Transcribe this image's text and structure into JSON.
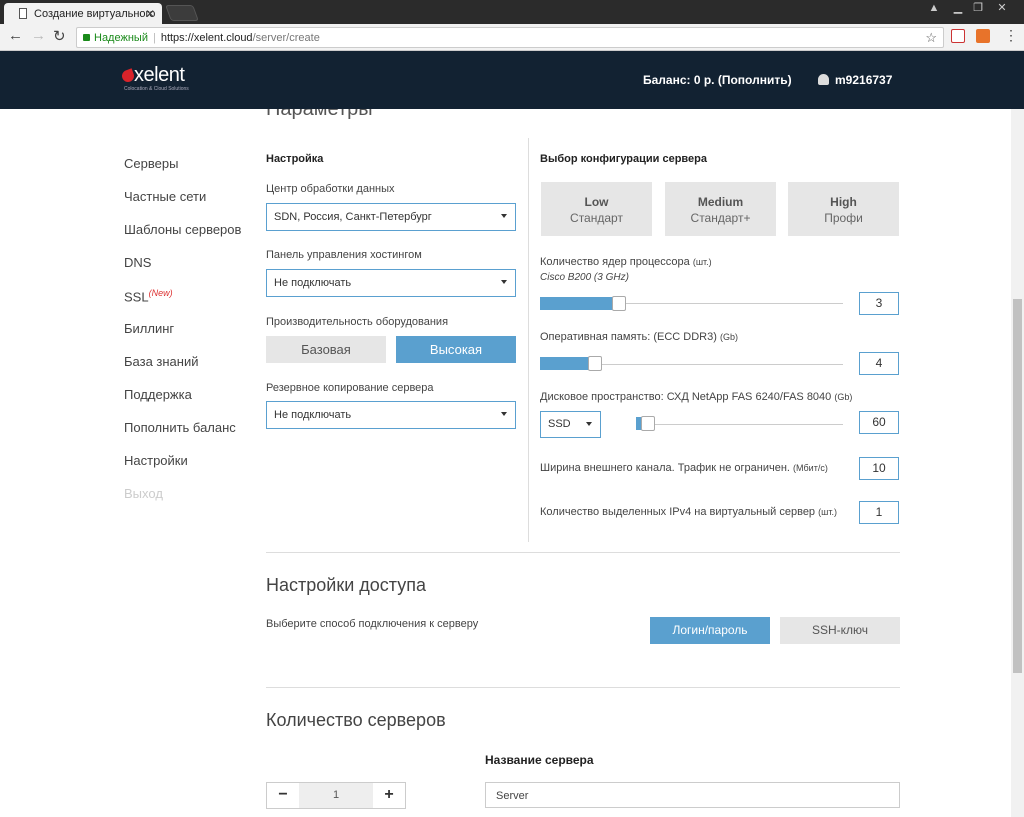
{
  "browser": {
    "tab_title": "Создание виртуального",
    "secure_label": "Надежный",
    "url_host": "https://xelent.cloud",
    "url_path": "/server/create"
  },
  "site": {
    "logo_name": "xelent",
    "logo_tagline": "Colocation & Cloud Solutions",
    "balance": "Баланс: 0 р. (Пополнить)",
    "username": "m9216737"
  },
  "page_cut_title": "Параметры",
  "sidebar": {
    "items": [
      {
        "label": "Серверы"
      },
      {
        "label": "Частные сети"
      },
      {
        "label": "Шаблоны серверов"
      },
      {
        "label": "DNS"
      },
      {
        "label": "SSL",
        "badge": "(New)"
      },
      {
        "label": "Биллинг"
      },
      {
        "label": "База знаний"
      },
      {
        "label": "Поддержка"
      },
      {
        "label": "Пополнить баланс"
      },
      {
        "label": "Настройки"
      },
      {
        "label": "Выход"
      }
    ]
  },
  "settings": {
    "title": "Настройка",
    "datacenter_label": "Центр обработки данных",
    "datacenter_value": "SDN, Россия, Санкт-Петербург",
    "hosting_panel_label": "Панель управления хостингом",
    "hosting_panel_value": "Не подключать",
    "performance_label": "Производительность оборудования",
    "perf_basic": "Базовая",
    "perf_high": "Высокая",
    "backup_label": "Резервное копирование сервера",
    "backup_value": "Не подключать"
  },
  "config": {
    "title": "Выбор конфигурации сервера",
    "tiers": [
      {
        "name": "Low",
        "sub": "Стандарт"
      },
      {
        "name": "Medium",
        "sub": "Стандарт+"
      },
      {
        "name": "High",
        "sub": "Профи"
      }
    ],
    "cpu_label": "Количество ядер процессора",
    "cpu_unit": "(шт.)",
    "cpu_model": "Cisco B200 (3 GHz)",
    "cpu_value": "3",
    "cpu_level": 0.26,
    "ram_label": "Оперативная память: (ECC DDR3)",
    "ram_unit": "(Gb)",
    "ram_value": "4",
    "ram_level": 0.18,
    "disk_label": "Дисковое пространство: СХД NetApp FAS 6240/FAS 8040",
    "disk_unit": "(Gb)",
    "disk_type": "SSD",
    "disk_value": "60",
    "disk_level": 0.06,
    "bandwidth_label": "Ширина внешнего канала. Трафик не ограничен.",
    "bandwidth_unit": "(Мбит/с)",
    "bandwidth_value": "10",
    "ipv4_label": "Количество выделенных IPv4 на виртуальный сервер",
    "ipv4_unit": "(шт.)",
    "ipv4_value": "1"
  },
  "access": {
    "title": "Настройки доступа",
    "hint": "Выберите способ подключения к серверу",
    "login_password": "Логин/пароль",
    "ssh_key": "SSH-ключ"
  },
  "servers": {
    "title": "Количество серверов",
    "count": "1",
    "name_label": "Название сервера",
    "name_value": "Server"
  },
  "colors": {
    "accent": "#5aa0cf",
    "header_bg": "#122232",
    "badge": "#dd3333"
  }
}
